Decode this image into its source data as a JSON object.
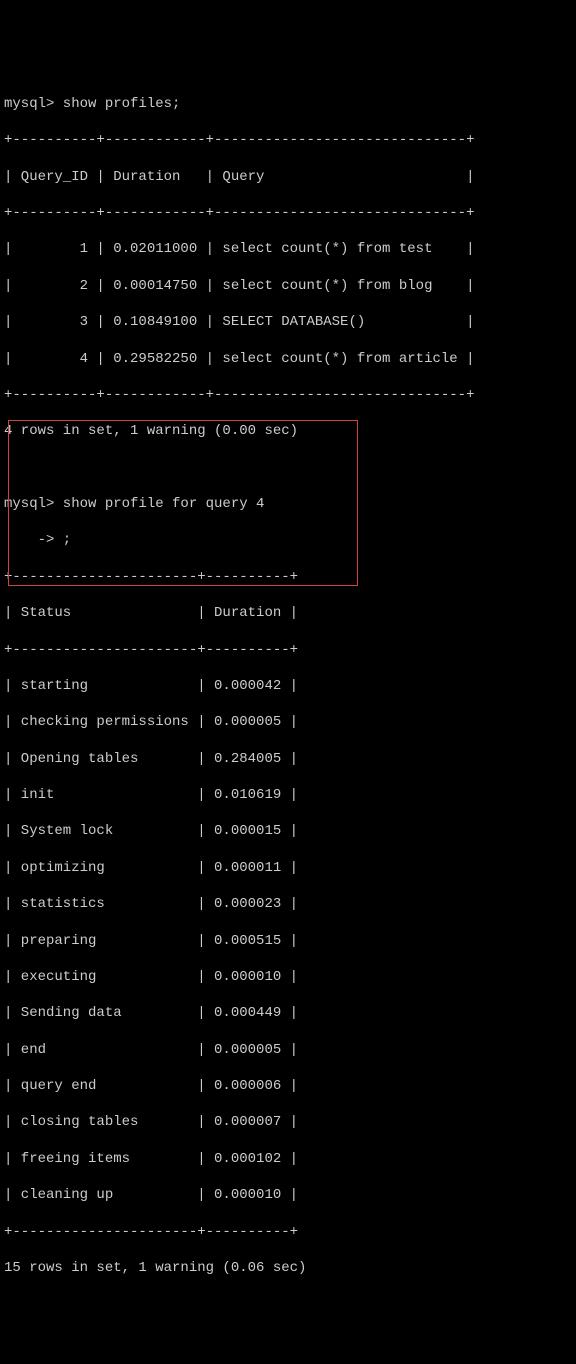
{
  "prompt1": "mysql> show profiles;",
  "table1": {
    "sep_top": "+----------+------------+------------------------------+",
    "header": "| Query_ID | Duration   | Query                        |",
    "sep_mid": "+----------+------------+------------------------------+",
    "rows": [
      "|        1 | 0.02011000 | select count(*) from test    |",
      "|        2 | 0.00014750 | select count(*) from blog    |",
      "|        3 | 0.10849100 | SELECT DATABASE()            |",
      "|        4 | 0.29582250 | select count(*) from article |"
    ],
    "sep_bot": "+----------+------------+------------------------------+"
  },
  "result1": "4 rows in set, 1 warning (0.00 sec)",
  "prompt2": "mysql> show profile for query 4",
  "prompt2b": "    -> ;",
  "table2": {
    "sep_top": "+----------------------+----------+",
    "header": "| Status               | Duration |",
    "sep_mid": "+----------------------+----------+",
    "rows": [
      "| starting             | 0.000042 |",
      "| checking permissions | 0.000005 |",
      "| Opening tables       | 0.284005 |",
      "| init                 | 0.010619 |",
      "| System lock          | 0.000015 |",
      "| optimizing           | 0.000011 |",
      "| statistics           | 0.000023 |",
      "| preparing            | 0.000515 |",
      "| executing            | 0.000010 |",
      "| Sending data         | 0.000449 |",
      "| end                  | 0.000005 |",
      "| query end            | 0.000006 |",
      "| closing tables       | 0.000007 |",
      "| freeing items        | 0.000102 |",
      "| cleaning up          | 0.000010 |"
    ],
    "sep_bot": "+----------------------+----------+"
  },
  "result2": "15 rows in set, 1 warning (0.06 sec)",
  "chart_data": {
    "type": "table",
    "tables": [
      {
        "title": "show profiles",
        "columns": [
          "Query_ID",
          "Duration",
          "Query"
        ],
        "rows": [
          [
            1,
            0.02011,
            "select count(*) from test"
          ],
          [
            2,
            0.0001475,
            "select count(*) from blog"
          ],
          [
            3,
            0.108491,
            "SELECT DATABASE()"
          ],
          [
            4,
            0.2958225,
            "select count(*) from article"
          ]
        ]
      },
      {
        "title": "show profile for query 4",
        "columns": [
          "Status",
          "Duration"
        ],
        "rows": [
          [
            "starting",
            4.2e-05
          ],
          [
            "checking permissions",
            5e-06
          ],
          [
            "Opening tables",
            0.284005
          ],
          [
            "init",
            0.010619
          ],
          [
            "System lock",
            1.5e-05
          ],
          [
            "optimizing",
            1.1e-05
          ],
          [
            "statistics",
            2.3e-05
          ],
          [
            "preparing",
            0.000515
          ],
          [
            "executing",
            1e-05
          ],
          [
            "Sending data",
            0.000449
          ],
          [
            "end",
            5e-06
          ],
          [
            "query end",
            6e-06
          ],
          [
            "closing tables",
            7e-06
          ],
          [
            "freeing items",
            0.000102
          ],
          [
            "cleaning up",
            1e-05
          ]
        ]
      }
    ]
  }
}
